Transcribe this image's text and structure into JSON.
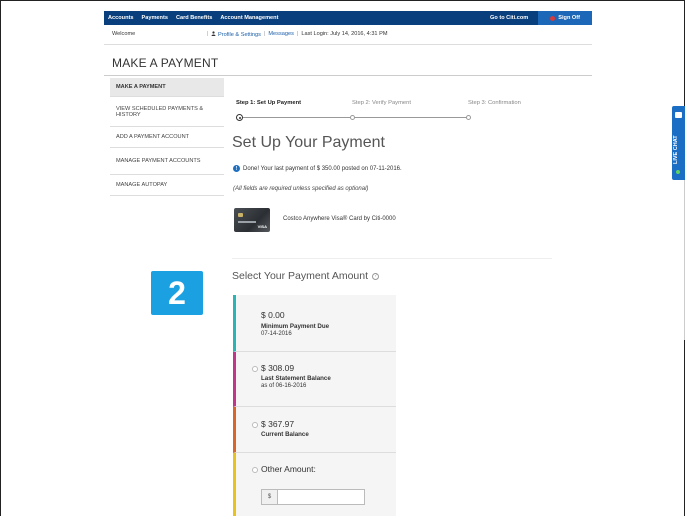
{
  "topnav": {
    "items": [
      "Accounts",
      "Payments",
      "Card Benefits",
      "Account Management"
    ],
    "goto": "Go to Citi.com",
    "signoff": "Sign Off"
  },
  "welcome_bar": {
    "welcome": "Welcome",
    "profile": "Profile & Settings",
    "messages": "Messages",
    "last_login": "Last Login: July 14, 2016, 4:31 PM"
  },
  "page_title": "MAKE A PAYMENT",
  "sidebar": {
    "items": [
      {
        "label": "MAKE A PAYMENT",
        "active": true
      },
      {
        "label": "VIEW SCHEDULED PAYMENTS & HISTORY",
        "active": false
      },
      {
        "label": "ADD A PAYMENT ACCOUNT",
        "active": false
      },
      {
        "label": "MANAGE PAYMENT ACCOUNTS",
        "active": false
      },
      {
        "label": "MANAGE AUTOPAY",
        "active": false
      }
    ]
  },
  "steps": [
    "Step 1: Set Up Payment",
    "Step 2: Verify Payment",
    "Step 3: Confirmation"
  ],
  "setup": {
    "title": "Set Up Your Payment",
    "done_message": "Done! Your last payment of $ 350.00 posted on 07-11-2016.",
    "required_note": "(All fields are required unless specified as optional)",
    "card_label": "Costco Anywhere Visa® Card by Citi-0000",
    "card_brand": "VISA"
  },
  "badge": "2",
  "select": {
    "title": "Select Your Payment Amount",
    "options": [
      {
        "amount": "$ 0.00",
        "label": "Minimum Payment Due",
        "sub": "07-14-2016",
        "color": "#2ab5b5",
        "radio": false
      },
      {
        "amount": "$ 308.09",
        "label": "Last Statement Balance",
        "sub": "as of 06-16-2016",
        "color": "#c2368a",
        "radio": true
      },
      {
        "amount": "$ 367.97",
        "label": "Current Balance",
        "sub": "",
        "color": "#d9652a",
        "radio": true
      },
      {
        "amount": "Other Amount:",
        "label": "",
        "sub": "",
        "color": "#e8c21e",
        "radio": true
      }
    ],
    "currency_prefix": "$"
  },
  "live_chat": "LIVE CHAT"
}
